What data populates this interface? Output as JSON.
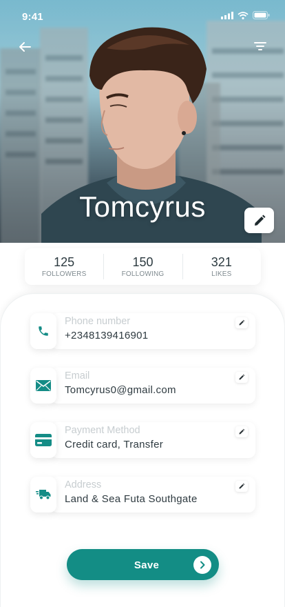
{
  "status_bar": {
    "time": "9:41"
  },
  "header": {
    "back_icon": "arrow-left-icon",
    "filter_icon": "filter-icon",
    "profile_name": "Tomcyrus",
    "edit_photo_icon": "pencil-icon"
  },
  "stats": [
    {
      "value": "125",
      "label": "FOLLOWERS"
    },
    {
      "value": "150",
      "label": "FOLLOWING"
    },
    {
      "value": "321",
      "label": "LIKES"
    }
  ],
  "fields": [
    {
      "icon": "phone-icon",
      "label": "Phone number",
      "value": "+2348139416901"
    },
    {
      "icon": "envelope-icon",
      "label": "Email",
      "value": "Tomcyrus0@gmail.com"
    },
    {
      "icon": "credit-card-icon",
      "label": "Payment Method",
      "value": "Credit card, Transfer"
    },
    {
      "icon": "delivery-truck-icon",
      "label": "Address",
      "value": "Land & Sea Futa Southgate"
    }
  ],
  "save_button": {
    "label": "Save",
    "icon": "chevron-right-icon"
  },
  "colors": {
    "accent": "#138d85",
    "text": "#2e3a40",
    "muted": "#c7cdd0"
  }
}
